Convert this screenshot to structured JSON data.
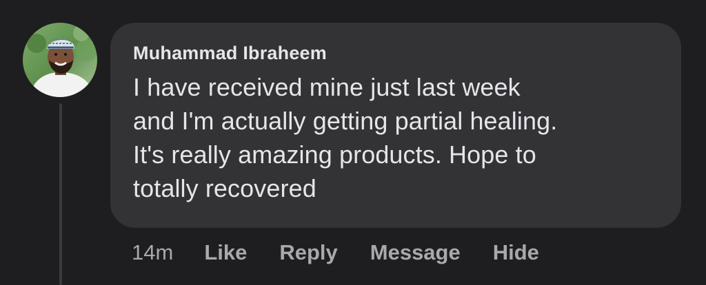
{
  "comment": {
    "author": "Muhammad Ibraheem",
    "text_lines": [
      "I have received mine just last week",
      "and I'm actually getting partial healing.",
      "It's really amazing products. Hope to",
      "totally recovered"
    ],
    "timestamp": "14m",
    "actions": {
      "like": "Like",
      "reply": "Reply",
      "message": "Message",
      "hide": "Hide"
    }
  },
  "theme": {
    "background": "#1e1e20",
    "bubble": "#333335",
    "text": "#e4e6eb",
    "muted": "#a8a9ad"
  }
}
